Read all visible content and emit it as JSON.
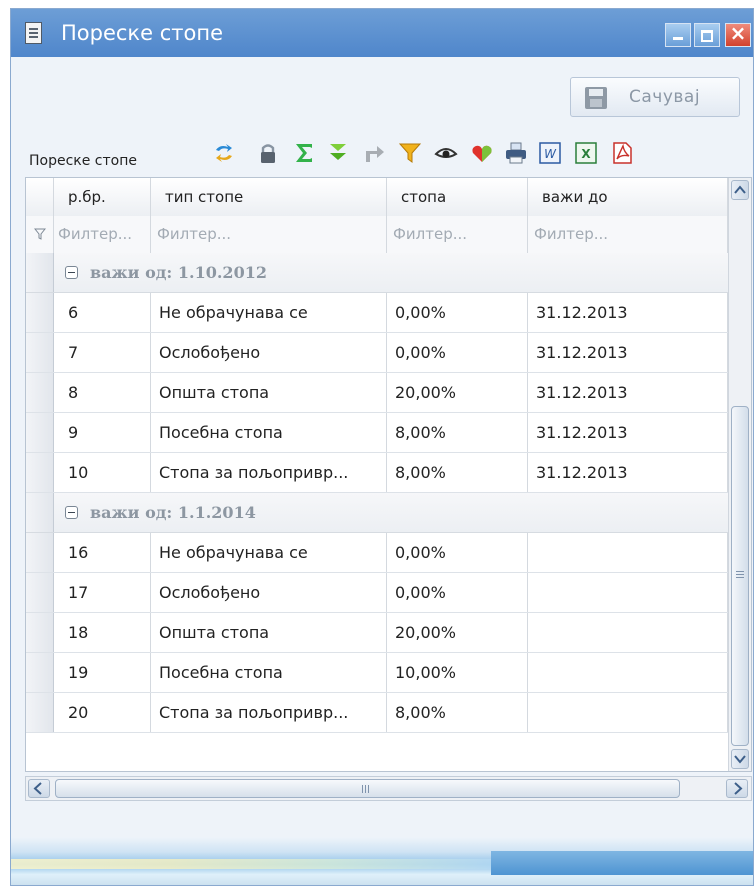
{
  "window": {
    "title": "Пореске стопе"
  },
  "toolbar": {
    "save_label": "Сачувај"
  },
  "grid": {
    "caption": "Пореске стопе",
    "columns": [
      "р.бр.",
      "тип стопе",
      "стопа",
      "важи до"
    ],
    "filter_placeholder": "Филтер...",
    "groups": [
      {
        "title": "важи од: 1.10.2012",
        "rows": [
          {
            "no": "6",
            "type": "Не обрачунава се",
            "rate": "0,00%",
            "valid_to": "31.12.2013"
          },
          {
            "no": "7",
            "type": "Ослобођено",
            "rate": "0,00%",
            "valid_to": "31.12.2013"
          },
          {
            "no": "8",
            "type": "Општа стопа",
            "rate": "20,00%",
            "valid_to": "31.12.2013"
          },
          {
            "no": "9",
            "type": "Посебна стопа",
            "rate": "8,00%",
            "valid_to": "31.12.2013"
          },
          {
            "no": "10",
            "type": "Стопа за пољопривр...",
            "rate": "8,00%",
            "valid_to": "31.12.2013"
          }
        ]
      },
      {
        "title": "важи од: 1.1.2014",
        "rows": [
          {
            "no": "16",
            "type": "Не обрачунава се",
            "rate": "0,00%",
            "valid_to": ""
          },
          {
            "no": "17",
            "type": "Ослобођено",
            "rate": "0,00%",
            "valid_to": ""
          },
          {
            "no": "18",
            "type": "Општа стопа",
            "rate": "20,00%",
            "valid_to": ""
          },
          {
            "no": "19",
            "type": "Посебна стопа",
            "rate": "10,00%",
            "valid_to": ""
          },
          {
            "no": "20",
            "type": "Стопа за пољопривр...",
            "rate": "8,00%",
            "valid_to": ""
          }
        ]
      }
    ]
  },
  "icons": {
    "title": "document-icon",
    "toolbar": [
      "refresh-icon",
      "lock-icon",
      "sum-icon",
      "expand-down-icon",
      "forward-arrow-icon",
      "filter-icon",
      "view-eye-icon",
      "favorite-heart-icon",
      "print-icon",
      "word-export-icon",
      "excel-export-icon",
      "pdf-export-icon"
    ]
  },
  "colors": {
    "titlebar": "#4f86cb",
    "window_bg": "#eef3f9",
    "group_text": "#8d97a2"
  }
}
